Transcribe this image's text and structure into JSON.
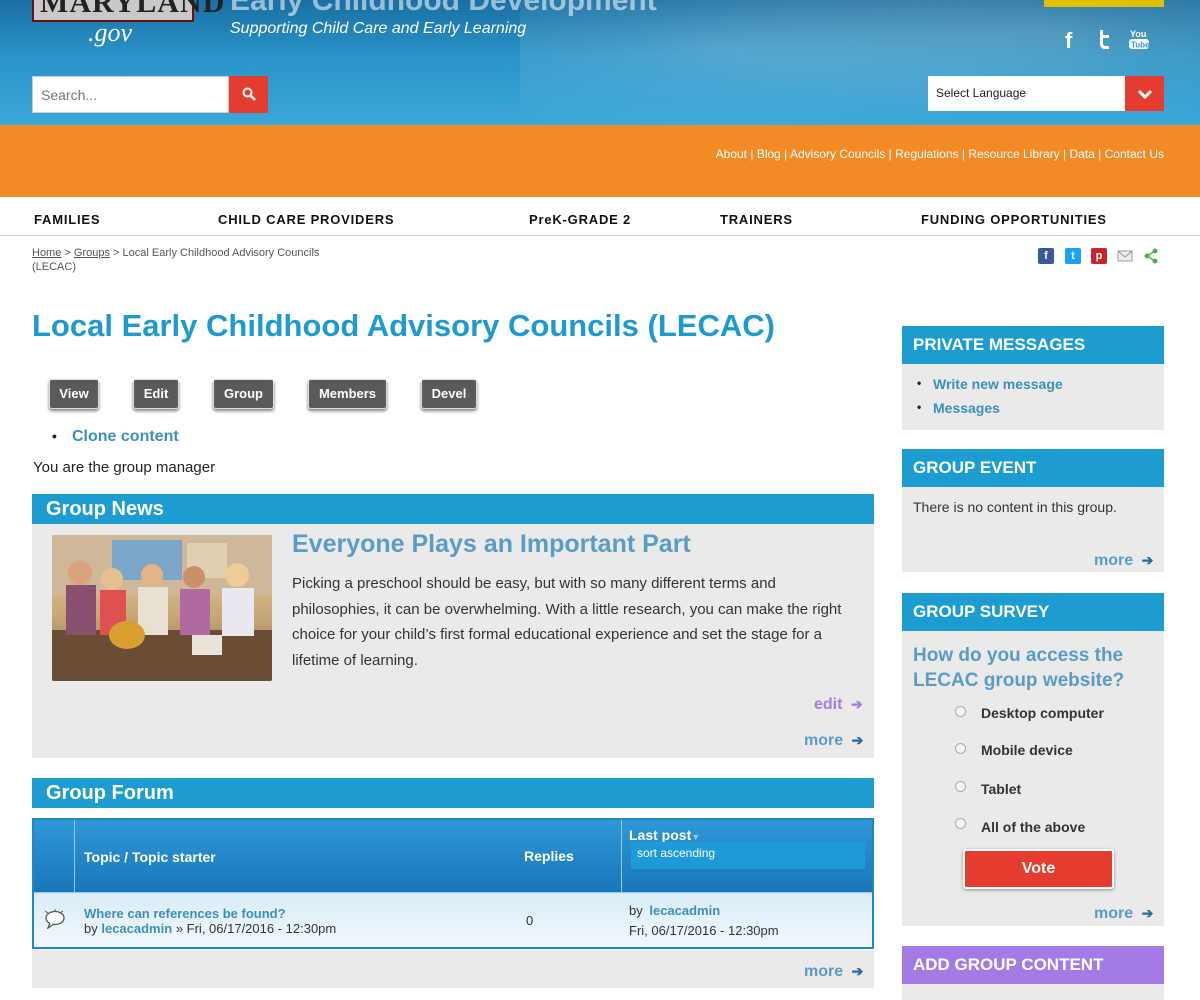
{
  "header": {
    "logo_text": "MARYLAND",
    "logo_suffix": ".gov",
    "site_title": "Early Childhood Development",
    "tagline": "Supporting Child Care and Early Learning",
    "social": [
      "facebook-icon",
      "twitter-icon",
      "youtube-icon"
    ],
    "search_placeholder": "Search...",
    "language_select": "Select Language"
  },
  "util_links": [
    "About",
    "Blog",
    "Advisory Councils",
    "Regulations",
    "Resource Library",
    "Data",
    "Contact Us"
  ],
  "nav": [
    "FAMILIES",
    "CHILD CARE PROVIDERS",
    "PreK-GRADE 2",
    "TRAINERS",
    "FUNDING OPPORTUNITIES"
  ],
  "breadcrumb": {
    "home": "Home",
    "sep": ">",
    "groups": "Groups",
    "current": "Local Early Childhood Advisory Councils (LECAC)"
  },
  "page_title": "Local Early Childhood Advisory Councils (LECAC)",
  "tabs": [
    "View",
    "Edit",
    "Group",
    "Members",
    "Devel"
  ],
  "clone_link": "Clone content",
  "manager_text": "You are the group manager",
  "group_news": {
    "heading": "Group News",
    "title": "Everyone Plays an Important Part",
    "text": "Picking a preschool should be easy, but with so many different terms and philosophies, it can be overwhelming. With a little research, you can make the right choice for your child’s first formal educational experience and set the stage for a lifetime of learning.",
    "edit": "edit",
    "more": "more"
  },
  "group_forum": {
    "heading": "Group Forum",
    "columns": {
      "topic": "Topic / Topic starter",
      "replies": "Replies",
      "last_post": "Last post",
      "sort": "sort ascending"
    },
    "rows": [
      {
        "topic": "Where can references be found?",
        "by": "by",
        "author": "lecacadmin",
        "date": "» Fri, 06/17/2016 - 12:30pm",
        "replies": "0",
        "last_by": "by",
        "last_author": "lecacadmin",
        "last_date": "Fri, 06/17/2016 - 12:30pm"
      }
    ],
    "more": "more"
  },
  "sidebar": {
    "private_messages": {
      "heading": "PRIVATE MESSAGES",
      "links": [
        "Write new message",
        "Messages"
      ]
    },
    "group_event": {
      "heading": "GROUP EVENT",
      "text": "There is no content in this group.",
      "more": "more"
    },
    "group_survey": {
      "heading": "GROUP SURVEY",
      "question": "How do you access the LECAC group website?",
      "options": [
        "Desktop computer",
        "Mobile device",
        "Tablet",
        "All of the above"
      ],
      "vote": "Vote",
      "more": "more"
    },
    "add_group_content": {
      "heading": "ADD GROUP CONTENT"
    }
  },
  "colors": {
    "header_blue": "#2a93c8",
    "util_orange": "#f28a26",
    "title_blue": "#1e9ad0",
    "accent_red": "#e63c2f",
    "add_content_purple": "#a47be6"
  }
}
